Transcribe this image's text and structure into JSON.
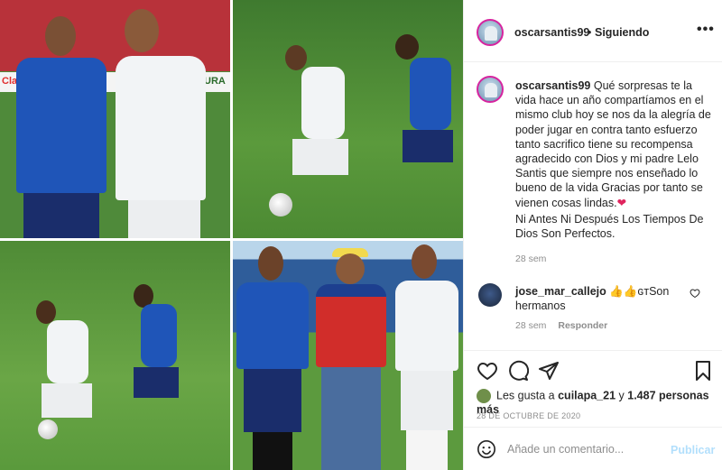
{
  "post": {
    "username": "oscarsantis99",
    "follow_separator": "•",
    "follow_status": "Siguiendo",
    "more_label": "•••"
  },
  "media": {
    "banner_left_text": "Clar",
    "banner_right_text": "URA",
    "photos": [
      "photo-1",
      "photo-2",
      "photo-3",
      "photo-4"
    ]
  },
  "caption": {
    "username": "oscarsantis99",
    "text": " Qué sorpresas te la vida hace un año compartíamos en el mismo club hoy se nos da la alegría de poder jugar en contra tanto esfuerzo tanto sacrifico tiene su recompensa agradecido con Dios y mi padre Lelo Santis que siempre nos enseñado lo bueno de la vida Gracias por tanto se vienen cosas lindas.",
    "emoji": "❤",
    "second_line": "Ni Antes Ni Después Los Tiempos De Dios Son Perfectos.",
    "time": "28 sem"
  },
  "comment": {
    "username": "jose_mar_callejo",
    "text": " 👍👍ɢᴛSon hermanos",
    "time": "28 sem",
    "reply_label": "Responder"
  },
  "engagement": {
    "likes_prefix": "Les gusta a ",
    "liked_by": "cuilapa_21",
    "likes_middle": " y ",
    "others_count": "1.487 personas más",
    "date": "28 DE OCTUBRE DE 2020"
  },
  "add_comment": {
    "placeholder": "Añade un comentario...",
    "post_label": "Publicar"
  },
  "colors": {
    "text": "#262626",
    "muted": "#8e8e8e",
    "post_button_disabled": "#b2dffc",
    "heart": "#e0245e"
  }
}
